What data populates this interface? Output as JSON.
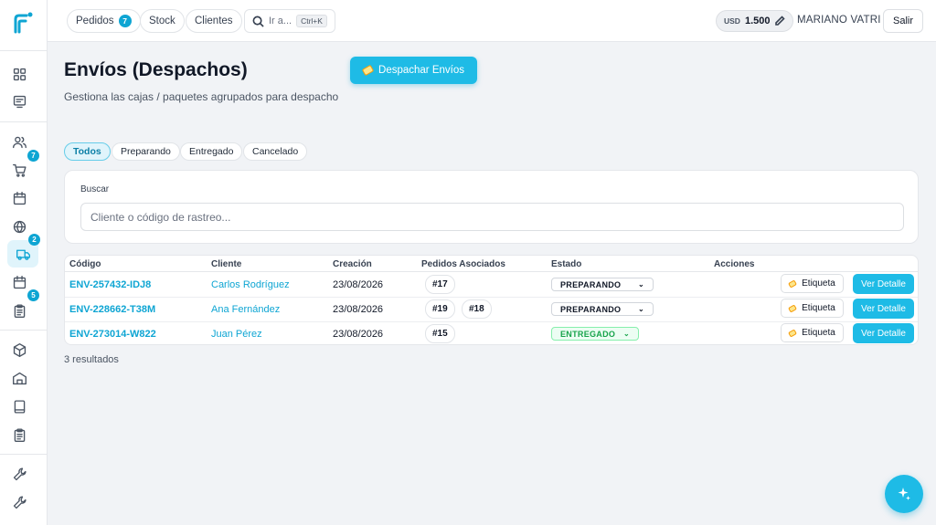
{
  "topbar": {
    "pills": [
      {
        "label": "Pedidos",
        "count": "7"
      },
      {
        "label": "Stock"
      },
      {
        "label": "Clientes"
      }
    ],
    "search_label": "Ir a...",
    "search_shortcut": "Ctrl+K",
    "currency": "USD",
    "amount": "1.500",
    "user": "MARIANO VATRI",
    "logout": "Salir"
  },
  "sidebar": {
    "icons": [
      "grid-icon",
      "monitor-icon",
      "users-icon",
      "cart-icon",
      "calendar-icon",
      "globe-icon",
      "truck-icon",
      "calendar-icon",
      "clipboard-icon",
      "box-icon",
      "warehouse-icon",
      "tablet-icon",
      "clipboard-icon",
      "wrench-icon",
      "wrench-icon"
    ],
    "badges": {
      "cart": "7",
      "truck": "2",
      "calendar2": "5"
    },
    "active": "truck-icon"
  },
  "page": {
    "title": "Envíos (Despachos)",
    "subtitle": "Gestiona las cajas / paquetes agrupados para despacho",
    "dispatch_button": "Despachar Envíos"
  },
  "filters": [
    "Todos",
    "Preparando",
    "Entregado",
    "Cancelado"
  ],
  "active_filter": "Todos",
  "search": {
    "label": "Buscar",
    "placeholder": "Cliente o código de rastreo..."
  },
  "table": {
    "headers": [
      "Código",
      "Cliente",
      "Creación",
      "Pedidos Asociados",
      "Estado",
      "Acciones"
    ],
    "rows": [
      {
        "code": "ENV-257432-IDJ8",
        "client": "Carlos Rodríguez",
        "date": "23/08/2026",
        "orders": [
          "#17"
        ],
        "status": "PREPARANDO",
        "label_btn": "Etiqueta",
        "detail_btn": "Ver Detalle"
      },
      {
        "code": "ENV-228662-T38M",
        "client": "Ana Fernández",
        "date": "23/08/2026",
        "orders": [
          "#19",
          "#18"
        ],
        "status": "PREPARANDO",
        "label_btn": "Etiqueta",
        "detail_btn": "Ver Detalle"
      },
      {
        "code": "ENV-273014-W822",
        "client": "Juan Pérez",
        "date": "23/08/2026",
        "orders": [
          "#15"
        ],
        "status": "ENTREGADO",
        "label_btn": "Etiqueta",
        "detail_btn": "Ver Detalle"
      }
    ]
  },
  "results_text": "3 resultados",
  "colors": {
    "accent": "#1ebbe6",
    "accent_dark": "#0ea5d3",
    "success": "#16a34a"
  }
}
